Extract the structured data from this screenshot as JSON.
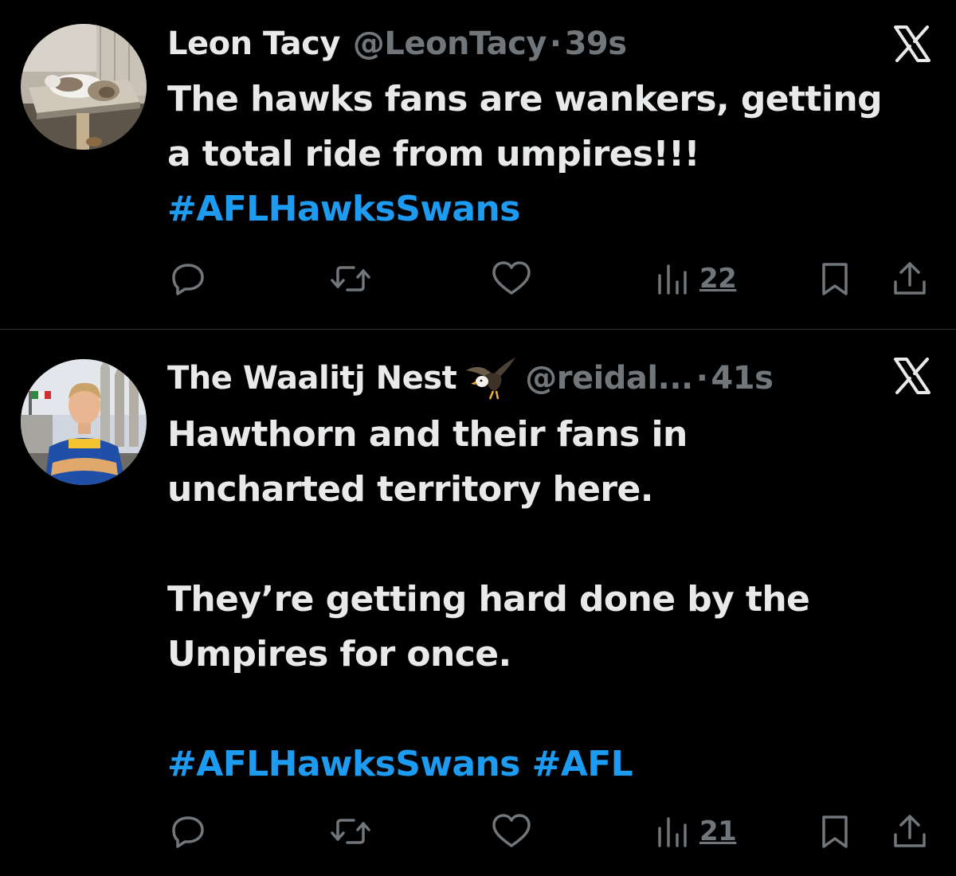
{
  "colors": {
    "background": "#000000",
    "text_primary": "#e7e9ea",
    "text_secondary": "#71767b",
    "hashtag": "#1d9bf0",
    "divider": "#2f3336"
  },
  "tweets": [
    {
      "display_name": "Leon Tacy",
      "handle": "@LeonTacy",
      "separator": "·",
      "time": "39s",
      "avatar_icon": "cat-on-cat-tree-avatar",
      "body_lines": [
        "The hawks fans are wankers, getting",
        "a total ride from umpires!!!"
      ],
      "hashtags": [
        "#AFLHawksSwans"
      ],
      "views": "22",
      "actions": [
        "reply-icon",
        "retweet-icon",
        "like-icon",
        "views-icon",
        "bookmark-icon",
        "share-icon"
      ]
    },
    {
      "display_name": "The Waalitj Nest",
      "name_badge_icon": "eagle-emoji",
      "handle": "@reidal...",
      "separator": "·",
      "time": "41s",
      "avatar_icon": "player-photo-avatar",
      "body_lines": [
        "Hawthorn and their fans in",
        "uncharted territory here."
      ],
      "body_lines_2": [
        "They’re getting hard done by the",
        "Umpires for once."
      ],
      "hashtags": [
        "#AFLHawksSwans",
        "#AFL"
      ],
      "views": "21",
      "actions": [
        "reply-icon",
        "retweet-icon",
        "like-icon",
        "views-icon",
        "bookmark-icon",
        "share-icon"
      ]
    }
  ]
}
